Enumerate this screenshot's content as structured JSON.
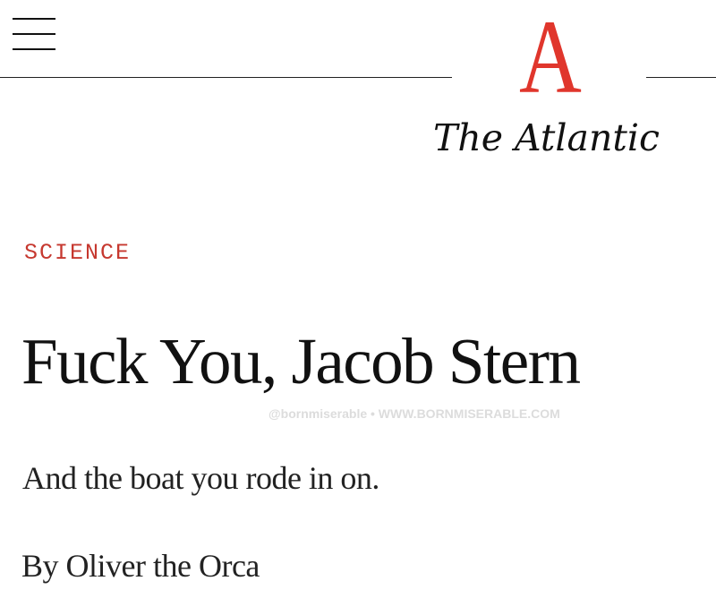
{
  "header": {
    "menu_icon": "hamburger-menu-icon",
    "logo": {
      "letter": "A",
      "wordmark": "The Atlantic"
    }
  },
  "article": {
    "section": "SCIENCE",
    "headline": "Fuck You, Jacob Stern",
    "subheadline": "And the boat you rode in on.",
    "byline": "By Oliver the Orca"
  },
  "watermark": "@bornmiserable • WWW.BORNMISERABLE.COM",
  "colors": {
    "logo_accent": "#e0362c",
    "section_label": "#c6382f",
    "text": "#111111",
    "watermark": "#dcdcdc"
  }
}
